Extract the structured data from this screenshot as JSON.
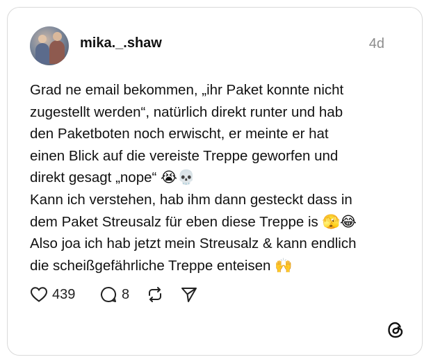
{
  "post": {
    "username": "mika._.shaw",
    "time_ago": "4d",
    "text": "Grad ne email bekommen, „ihr Paket konnte nicht\nzugestellt werden“, natürlich direkt runter und hab\nden Paketboten noch erwischt, er meinte er hat\neinen Blick auf die vereiste Treppe geworfen und\ndirekt gesagt „nope“ 😭💀\nKann ich verstehen, hab ihm dann gesteckt dass in\ndem Paket Streusalz für eben diese Treppe is 🫣😂\nAlso joa ich hab jetzt mein Streusalz & kann endlich\ndie scheißgefährliche Treppe enteisen 🙌"
  },
  "actions": {
    "like_count": "439",
    "reply_count": "8",
    "like_icon": "heart-icon",
    "reply_icon": "speech-bubble-icon",
    "repost_icon": "repost-icon",
    "share_icon": "send-icon"
  },
  "brand": {
    "logo_icon": "threads-logo-icon"
  }
}
